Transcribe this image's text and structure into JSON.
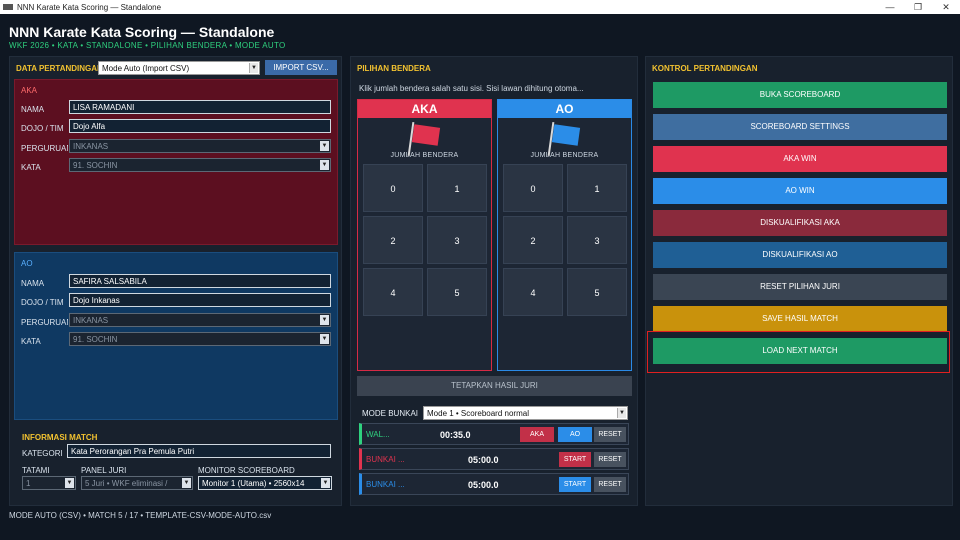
{
  "window": {
    "title": "NNN Karate Kata Scoring — Standalone",
    "icon_text": "NNN",
    "minimize": "—",
    "maximize": "❐",
    "close": "✕"
  },
  "header": {
    "title": "NNN Karate Kata Scoring — Standalone",
    "subtitle": "WKF 2026 • KATA • STANDALONE • PILIHAN BENDERA • MODE AUTO"
  },
  "left_panel": {
    "title": "DATA PERTANDINGAN",
    "mode_value": "Mode Auto (Import CSV)",
    "import_label": "IMPORT CSV...",
    "aka": {
      "heading": "AKA",
      "nama_label": "NAMA",
      "nama": "LISA RAMADANI",
      "dojo_label": "DOJO / TIM",
      "dojo": "Dojo Alfa",
      "perguruan_label": "PERGURUAN",
      "perguruan": "INKANAS",
      "kata_label": "KATA",
      "kata": "91. SOCHIN"
    },
    "ao": {
      "heading": "AO",
      "nama_label": "NAMA",
      "nama": "SAFIRA SALSABILA",
      "dojo_label": "DOJO / TIM",
      "dojo": "Dojo Inkanas",
      "perguruan_label": "PERGURUAN",
      "perguruan": "INKANAS",
      "kata_label": "KATA",
      "kata": "91. SOCHIN"
    },
    "info": {
      "title": "INFORMASI MATCH",
      "kategori_label": "KATEGORI",
      "kategori": "Kata Perorangan Pra Pemula Putri",
      "tatami_label": "TATAMI",
      "tatami": "1",
      "panel_label": "PANEL JURI",
      "panel": "5 Juri • WKF eliminasi / ",
      "monitor_label": "MONITOR SCOREBOARD",
      "monitor": "Monitor 1 (Utama) • 2560x14"
    }
  },
  "middle_panel": {
    "title": "PILIHAN BENDERA",
    "description": "Klik jumlah bendera salah satu sisi. Sisi lawan dihitung otoma...",
    "aka_head": "AKA",
    "ao_head": "AO",
    "jumlah_label": "JUMLAH BENDERA",
    "numbers": [
      "0",
      "1",
      "2",
      "3",
      "4",
      "5"
    ],
    "tetapkan_label": "TETAPKAN HASIL JURI",
    "mode_bunkai_label": "MODE BUNKAI",
    "mode_bunkai_value": "Mode 1 • Scoreboard normal",
    "timers": [
      {
        "name": "WAL...",
        "time": "00:35.0",
        "color": "#2fd17f"
      },
      {
        "name": "BUNKAI ...",
        "time": "05:00.0",
        "color": "#e0334f"
      },
      {
        "name": "BUNKAI ...",
        "time": "05:00.0",
        "color": "#2b8de8"
      }
    ],
    "aka_btn": "AKA",
    "ao_btn": "AO",
    "start_label": "START",
    "reset_label": "RESET"
  },
  "right_panel": {
    "title": "KONTROL PERTANDINGAN",
    "buttons": [
      {
        "label": "BUKA SCOREBOARD",
        "color": "#1e9a64"
      },
      {
        "label": "SCOREBOARD SETTINGS",
        "color": "#3f6ea0"
      },
      {
        "label": "AKA WIN",
        "color": "#e0334f"
      },
      {
        "label": "AO WIN",
        "color": "#2b8de8"
      },
      {
        "label": "DISKUALIFIKASI AKA",
        "color": "#8a2a3c"
      },
      {
        "label": "DISKUALIFIKASI AO",
        "color": "#1f5f95"
      },
      {
        "label": "RESET PILIHAN JURI",
        "color": "#3a4553"
      },
      {
        "label": "SAVE HASIL MATCH",
        "color": "#c9920c"
      },
      {
        "label": "LOAD NEXT MATCH",
        "color": "#1e9a64"
      }
    ]
  },
  "status": "MODE AUTO (CSV) • MATCH 5 / 17 • TEMPLATE-CSV-MODE-AUTO.csv",
  "colors": {
    "accent_title": "#f2c230",
    "aka": "#e0334f",
    "ao": "#2b8de8",
    "green": "#1e9a64"
  }
}
